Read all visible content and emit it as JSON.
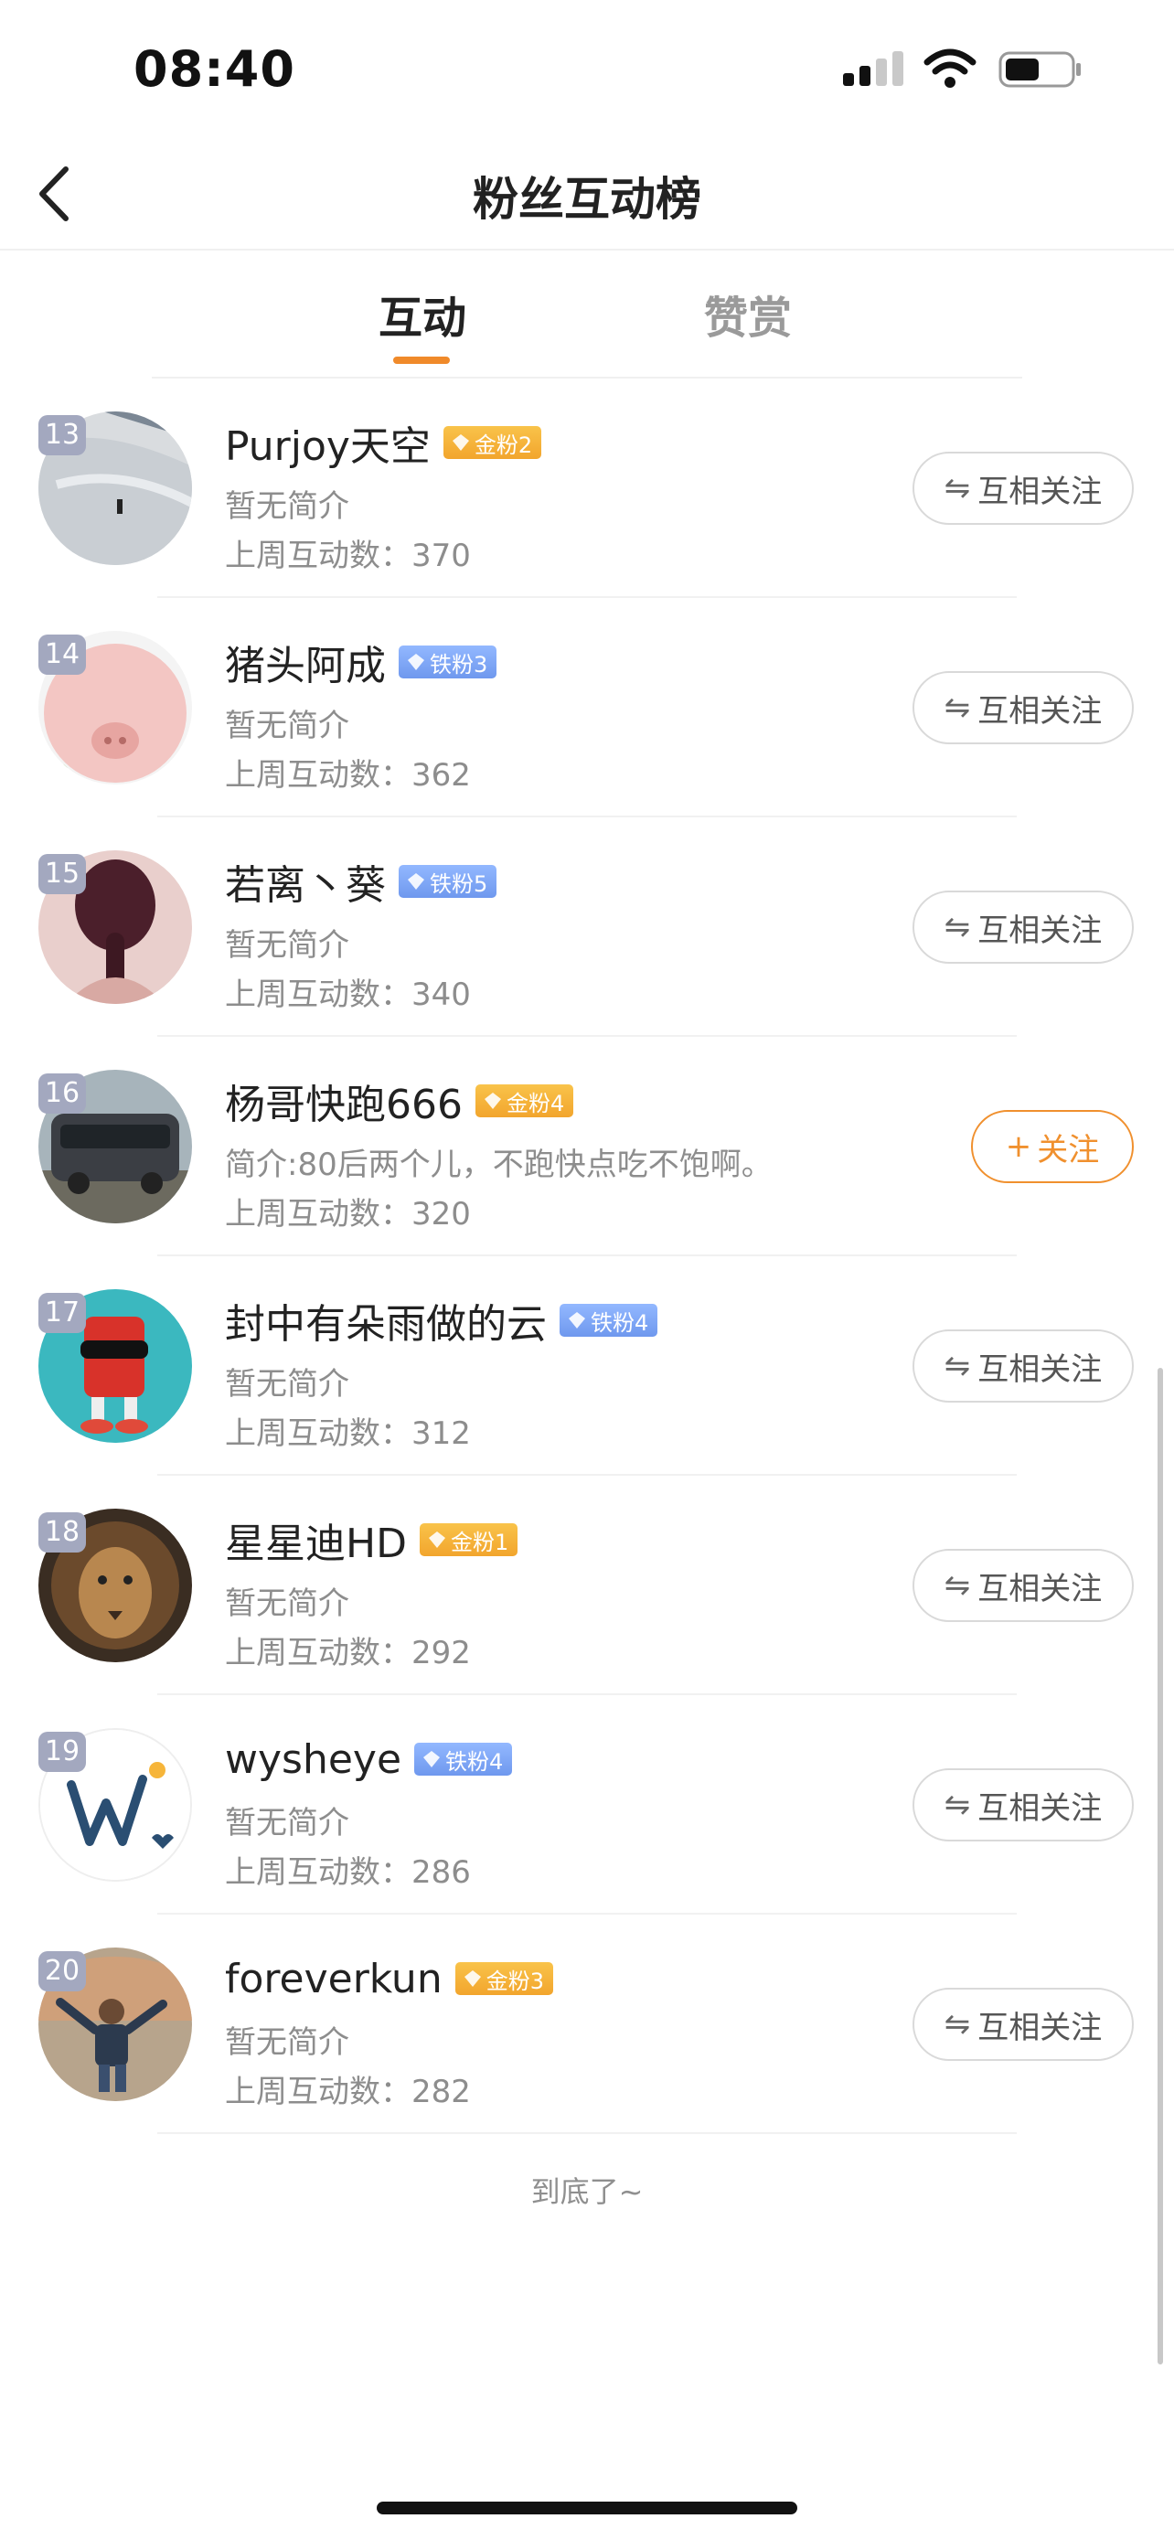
{
  "status_bar": {
    "time": "08:40"
  },
  "nav": {
    "title": "粉丝互动榜"
  },
  "tabs": [
    {
      "label": "互动",
      "active": true
    },
    {
      "label": "赞赏",
      "active": false
    }
  ],
  "list": {
    "count_prefix": "上周互动数：",
    "mutual_label": "互相关注",
    "mutual_icon": "⇋",
    "follow_label": "关注",
    "follow_icon": "+",
    "items": [
      {
        "rank": "13",
        "name": "Purjoy天空",
        "badge": "金粉2",
        "badge_type": "gold",
        "bio": "暂无简介",
        "count": "370",
        "action": "mutual"
      },
      {
        "rank": "14",
        "name": "猪头阿成",
        "badge": "铁粉3",
        "badge_type": "iron",
        "bio": "暂无简介",
        "count": "362",
        "action": "mutual"
      },
      {
        "rank": "15",
        "name": "若离丶葵",
        "badge": "铁粉5",
        "badge_type": "iron",
        "bio": "暂无简介",
        "count": "340",
        "action": "mutual"
      },
      {
        "rank": "16",
        "name": "杨哥快跑666",
        "badge": "金粉4",
        "badge_type": "gold",
        "bio": "简介:80后两个儿，不跑快点吃不饱啊。",
        "count": "320",
        "action": "follow"
      },
      {
        "rank": "17",
        "name": "封中有朵雨做的云",
        "badge": "铁粉4",
        "badge_type": "iron",
        "bio": "暂无简介",
        "count": "312",
        "action": "mutual"
      },
      {
        "rank": "18",
        "name": "星星迪HD",
        "badge": "金粉1",
        "badge_type": "gold",
        "bio": "暂无简介",
        "count": "292",
        "action": "mutual"
      },
      {
        "rank": "19",
        "name": "wysheye",
        "badge": "铁粉4",
        "badge_type": "iron",
        "bio": "暂无简介",
        "count": "286",
        "action": "mutual"
      },
      {
        "rank": "20",
        "name": "foreverkun",
        "badge": "金粉3",
        "badge_type": "gold",
        "bio": "暂无简介",
        "count": "282",
        "action": "mutual"
      }
    ]
  },
  "footer": {
    "end_text": "到底了~"
  },
  "colors": {
    "accent": "#f08a2a",
    "gold_badge": "#f4b03a",
    "iron_badge": "#7aa3f2",
    "rank_badge": "#a3a8bf"
  },
  "icons": {
    "back": "chevron-left-icon",
    "mutual": "swap-arrows-icon",
    "follow": "plus-icon",
    "badge_gem": "diamond-icon"
  }
}
